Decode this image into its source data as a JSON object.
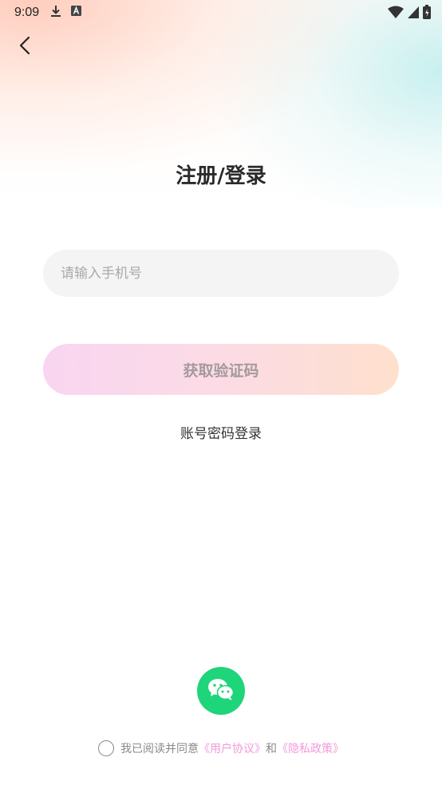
{
  "status_bar": {
    "time": "9:09",
    "icons_left": [
      "download-icon",
      "a-badge-icon"
    ],
    "icons_right": [
      "wifi-icon",
      "signal-icon",
      "battery-icon"
    ]
  },
  "header": {
    "back_icon": "chevron-left-icon"
  },
  "page": {
    "title": "注册/登录"
  },
  "phone_input": {
    "value": "",
    "placeholder": "请输入手机号"
  },
  "code_button": {
    "label": "获取验证码"
  },
  "password_login": {
    "label": "账号密码登录"
  },
  "wechat_login": {
    "icon": "wechat-icon",
    "color": "#1fd57a"
  },
  "agreement": {
    "prefix": "我已阅读并同意",
    "user_agreement": "《用户协议》",
    "conjunction": "和",
    "privacy_policy": "《隐私政策》",
    "link_color": "#f19ad9"
  }
}
